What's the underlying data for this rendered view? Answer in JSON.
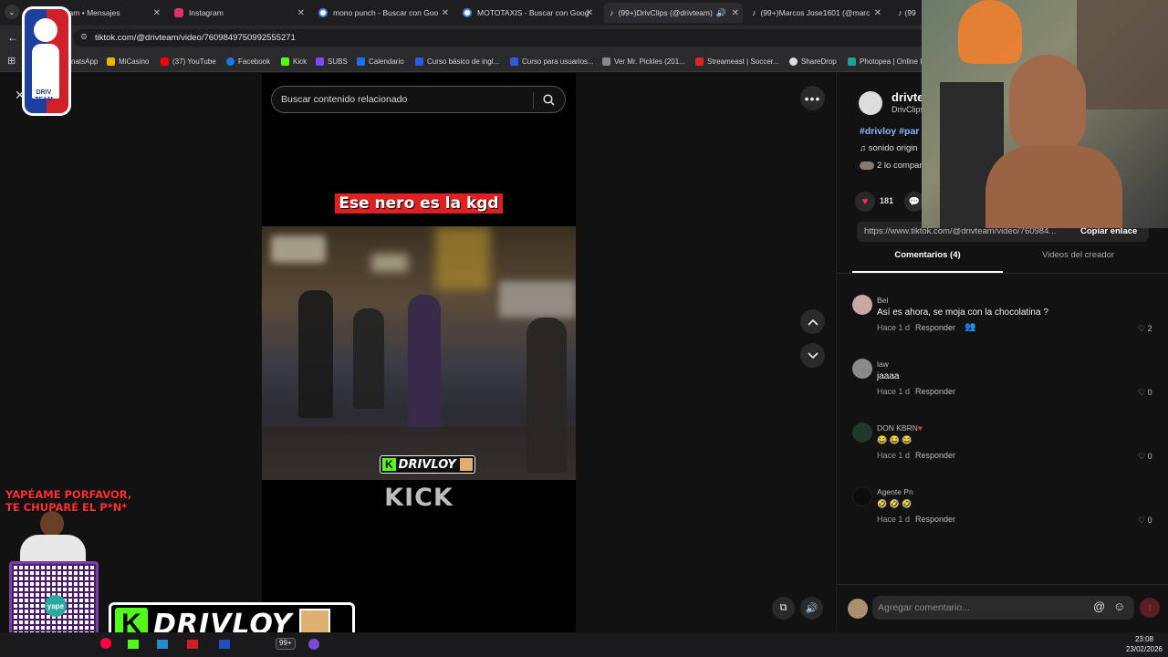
{
  "browser": {
    "tabs": [
      {
        "label": "gram • Mensajes",
        "color": "#c13584"
      },
      {
        "label": "Instagram",
        "color": "#e1306c"
      },
      {
        "label": "mono punch - Buscar con Goo",
        "color": "#4285f4"
      },
      {
        "label": "MOTOTAXIS - Buscar con Goog",
        "color": "#4285f4"
      },
      {
        "label": "(99+)DrivClips (@drivteam)",
        "color": "#000000"
      },
      {
        "label": "(99+)Marcos Jose1601 (@marc",
        "color": "#000000"
      },
      {
        "label": "(99",
        "color": "#000000"
      }
    ],
    "url": "tiktok.com/@drivteam/video/7609849750992555271",
    "bookmarks": [
      "natsApp",
      "MiCasino",
      "(37) YouTube",
      "Facebook",
      "Kick",
      "SUBS",
      "Calendario",
      "Curso básico de ingl...",
      "Curso para usuarios...",
      "Ver Mr. Pickles (201...",
      "Streameast | Soccer...",
      "ShareDrop",
      "Photopea | Online I"
    ]
  },
  "video": {
    "search_placeholder": "Buscar contenido relacionado",
    "caption": "Ese nero es la kgd",
    "watermark": "DRIVLOY",
    "kick_logo": "KICK"
  },
  "panel": {
    "author": "drivte",
    "author_sub": "DrivClips",
    "hashtags": "#drivloy #par",
    "sound": "sonido origin",
    "shared": "2 lo compar",
    "likes": "181",
    "link": "https://www.tiktok.com/@drivteam/video/760984...",
    "copy_link": "Copiar enlace",
    "tab_comments": "Comentarios (4)",
    "tab_creator": "Videos del creador",
    "comments": [
      {
        "name": "Bel",
        "text": "Así es ahora, se moja con la chocolatina ?",
        "time": "Hace 1 d",
        "reply": "Responder",
        "likes": "2"
      },
      {
        "name": "law",
        "text": "jaaaa",
        "time": "Hace 1 d",
        "reply": "Responder",
        "likes": "0"
      },
      {
        "name": "DON KBRN",
        "text": "😂 😂 😂",
        "time": "Hace 1 d",
        "reply": "Responder",
        "likes": "0"
      },
      {
        "name": "Agente Pn",
        "text": "🤣 🤣 🤣",
        "time": "Hace 1 d",
        "reply": "Responder",
        "likes": "0"
      }
    ],
    "add_comment_placeholder": "Agregar comentario..."
  },
  "overlay": {
    "logo_text": "DRIV TEAM",
    "yape_text_1": "YAPÉAME PORFAVOR,",
    "yape_text_2": "TE CHUPARÉ  EL P*N*",
    "qr_label": "yape",
    "banner_name": "DRIVLOY"
  },
  "taskbar": {
    "time": "23:08",
    "date": "23/02/2026",
    "badge": "99+"
  },
  "colors": {
    "accent_red": "#fe2c55",
    "kick_green": "#53fc18",
    "caption_red": "#e02020"
  }
}
